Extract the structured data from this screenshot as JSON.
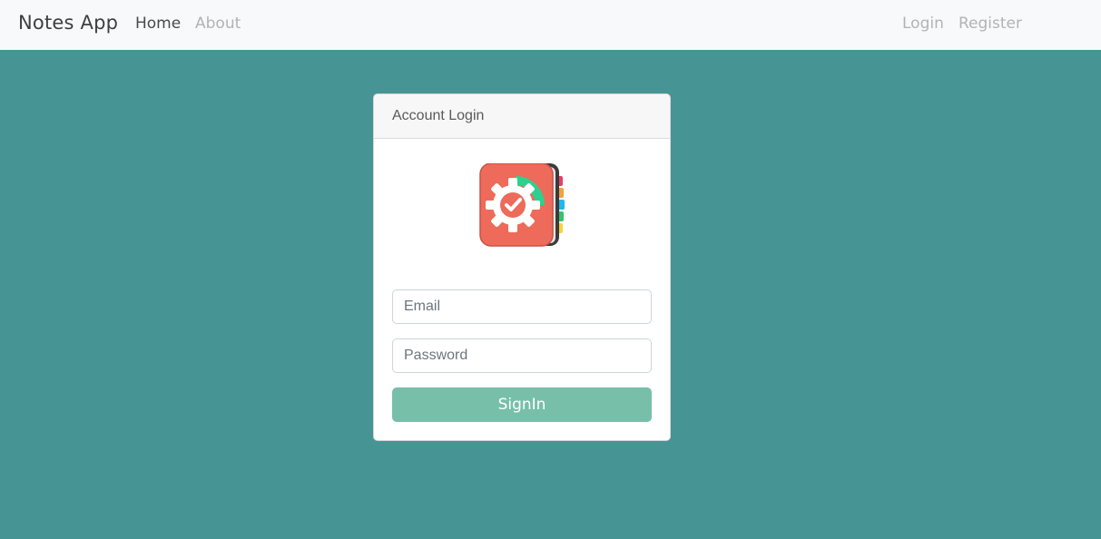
{
  "navbar": {
    "brand": "Notes App",
    "links": [
      {
        "label": "Home",
        "active": true
      },
      {
        "label": "About",
        "active": false
      }
    ],
    "right_links": [
      {
        "label": "Login"
      },
      {
        "label": "Register"
      }
    ]
  },
  "login_card": {
    "title": "Account Login",
    "logo_icon": "notebook-gear-icon",
    "email": {
      "value": "",
      "placeholder": "Email"
    },
    "password": {
      "value": "",
      "placeholder": "Password"
    },
    "submit_label": "SignIn"
  },
  "colors": {
    "background": "#469594",
    "navbar": "#f8f9fa",
    "button": "#78bfaa",
    "logo_cover": "#ee6a5a"
  }
}
